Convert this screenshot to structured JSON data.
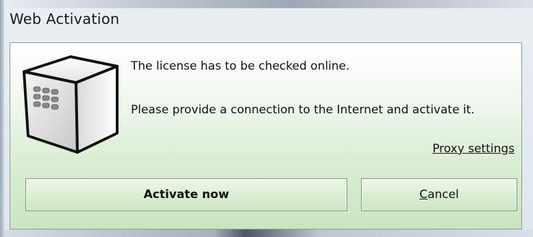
{
  "window": {
    "title": "Web Activation"
  },
  "message": {
    "line1": "The license has to be checked online.",
    "line2": "Please provide a connection to the Internet and activate it."
  },
  "links": {
    "proxy_settings": "Proxy settings"
  },
  "buttons": {
    "activate_label": "Activate now",
    "cancel_label": "Cancel"
  },
  "icons": {
    "device": "license-device-icon"
  },
  "colors": {
    "panel_gradient_top": "#ffffff",
    "panel_gradient_bottom": "#c9e5bf",
    "button_border": "#7f8f7a",
    "text": "#111111"
  }
}
